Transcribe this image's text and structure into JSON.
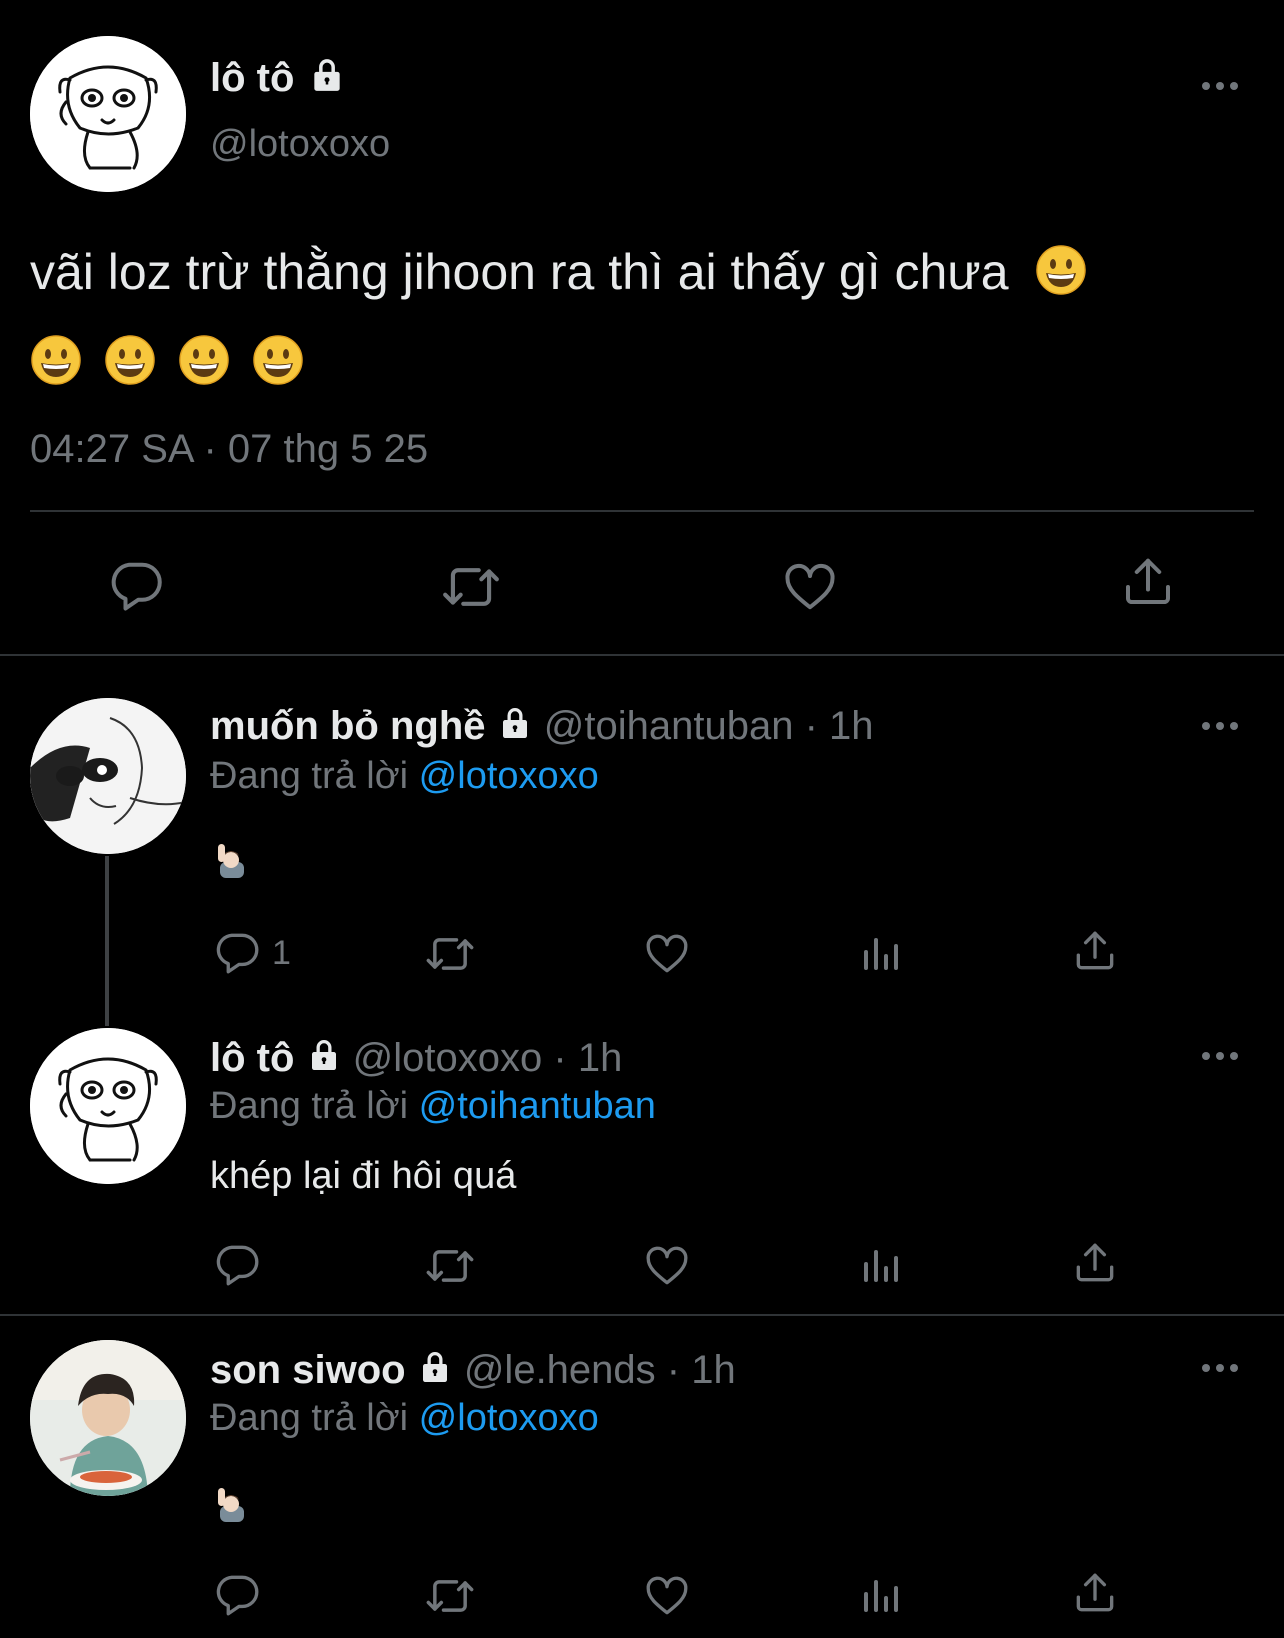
{
  "main_tweet": {
    "display_name": "lô tô",
    "handle": "@lotoxoxo",
    "text": "vãi loz trừ thằng jihoon ra thì ai thấy gì chưa",
    "timestamp": "04:27 SA · 07 thg 5 25",
    "icons": [
      "lock-icon",
      "grinning-face-emoji",
      "reply-icon",
      "retweet-icon",
      "like-icon",
      "share-icon",
      "more-icon"
    ]
  },
  "replies": [
    {
      "display_name": "muốn bỏ nghề",
      "handle": "@toihantuban",
      "time": "· 1h",
      "replying_prefix": "Đang trả lời",
      "replying_to": "@lotoxoxo",
      "text": "",
      "reply_count": "1",
      "emoji": "raising-hand-emoji"
    },
    {
      "display_name": "lô tô",
      "handle": "@lotoxoxo",
      "time": "· 1h",
      "replying_prefix": "Đang trả lời",
      "replying_to": "@toihantuban",
      "text": "khép lại đi hôi quá",
      "reply_count": ""
    },
    {
      "display_name": "son siwoo",
      "handle": "@le.hends",
      "time": "· 1h",
      "replying_prefix": "Đang trả lời",
      "replying_to": "@lotoxoxo",
      "text": "",
      "reply_count": "",
      "emoji": "raising-hand-emoji"
    }
  ],
  "colors": {
    "background": "#000000",
    "text": "#e7e9ea",
    "muted": "#71767b",
    "link": "#1d9bf0",
    "divider": "#2f3336"
  }
}
